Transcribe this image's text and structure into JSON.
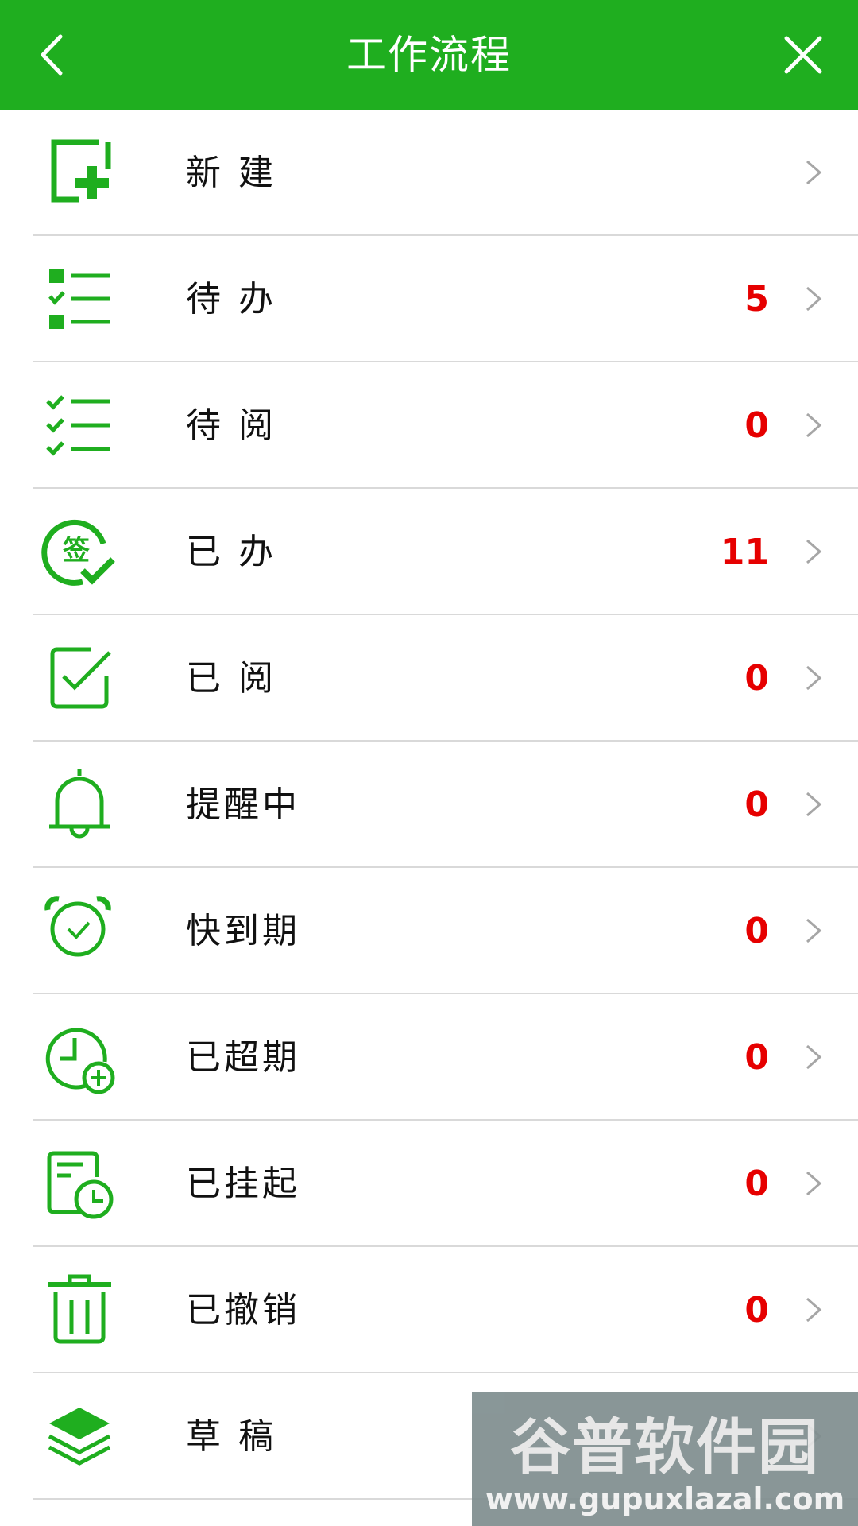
{
  "header": {
    "title": "工作流程",
    "back_icon": "chevron-left-icon",
    "close_icon": "close-icon",
    "bg_color": "#1fae1f"
  },
  "colors": {
    "accent_green": "#1fae1f",
    "count_red": "#e60000"
  },
  "items": [
    {
      "label": "新 建",
      "count": "",
      "icon": "new-document-icon"
    },
    {
      "label": "待 办",
      "count": "5",
      "icon": "todo-list-icon"
    },
    {
      "label": "待 阅",
      "count": "0",
      "icon": "to-read-checklist-icon"
    },
    {
      "label": "已 办",
      "count": "11",
      "icon": "signed-check-icon"
    },
    {
      "label": "已 阅",
      "count": "0",
      "icon": "checkbox-checked-icon"
    },
    {
      "label": "提醒中",
      "count": "0",
      "icon": "bell-icon"
    },
    {
      "label": "快到期",
      "count": "0",
      "icon": "alarm-clock-icon"
    },
    {
      "label": "已超期",
      "count": "0",
      "icon": "clock-plus-icon"
    },
    {
      "label": "已挂起",
      "count": "0",
      "icon": "document-clock-icon"
    },
    {
      "label": "已撤销",
      "count": "0",
      "icon": "trash-icon"
    },
    {
      "label": "草 稿",
      "count": "",
      "icon": "layers-icon"
    }
  ],
  "watermark": {
    "brand": "谷普软件园",
    "url": "www.gupuxlazal.com"
  }
}
